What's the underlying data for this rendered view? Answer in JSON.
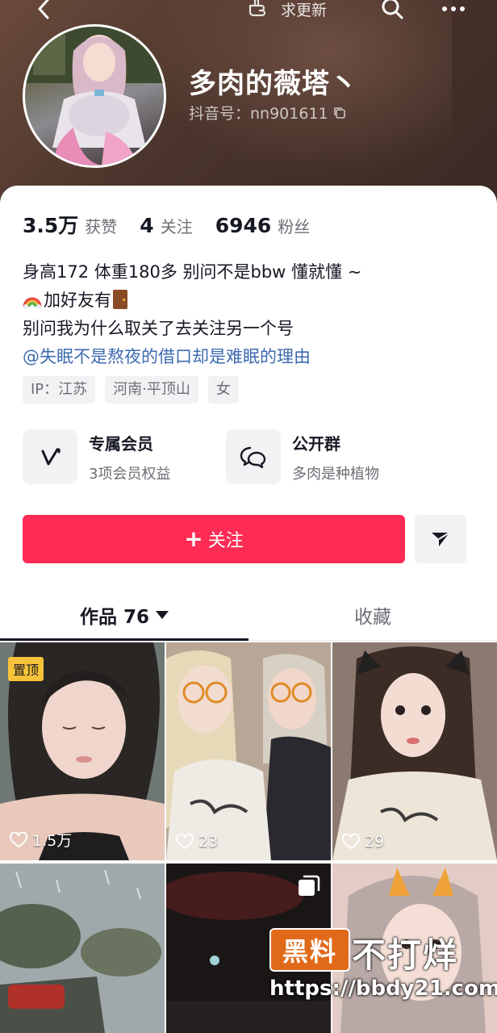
{
  "header": {
    "update_label": "求更新",
    "nickname": "多肉的薇塔丶",
    "douyin_id": "抖音号：nn901611"
  },
  "stats": [
    {
      "value": "3.5万",
      "label": "获赞"
    },
    {
      "value": "4",
      "label": "关注"
    },
    {
      "value": "6946",
      "label": "粉丝"
    }
  ],
  "bio": {
    "line1": "身高172  体重180多  别问不是bbw 懂就懂 ~",
    "line2": "加好友有",
    "line3": "别问我为什么取关了去关注另一个号",
    "mention": "@失眠不是熬夜的借口却是难眠的理由"
  },
  "tags": [
    "IP：江苏",
    "河南·平顶山",
    "女"
  ],
  "features": [
    {
      "title": "专属会员",
      "subtitle": "3项会员权益",
      "icon": "v-logo-icon"
    },
    {
      "title": "公开群",
      "subtitle": "多肉是种植物",
      "icon": "group-chat-icon"
    }
  ],
  "follow_label": "关注",
  "tabs": {
    "works": "作品 76",
    "favorites": "收藏"
  },
  "grid": [
    {
      "likes": "1.5万",
      "pinned": "置顶"
    },
    {
      "likes": "23"
    },
    {
      "likes": "29"
    },
    {},
    {
      "multi": true
    },
    {}
  ],
  "watermark": {
    "box": "黑料",
    "main": "不打烊",
    "url": "https://bbdy21.com"
  },
  "colors": {
    "accent": "#fe2c55",
    "mention": "#3d6ab0",
    "pinned": "#f6c23a"
  }
}
